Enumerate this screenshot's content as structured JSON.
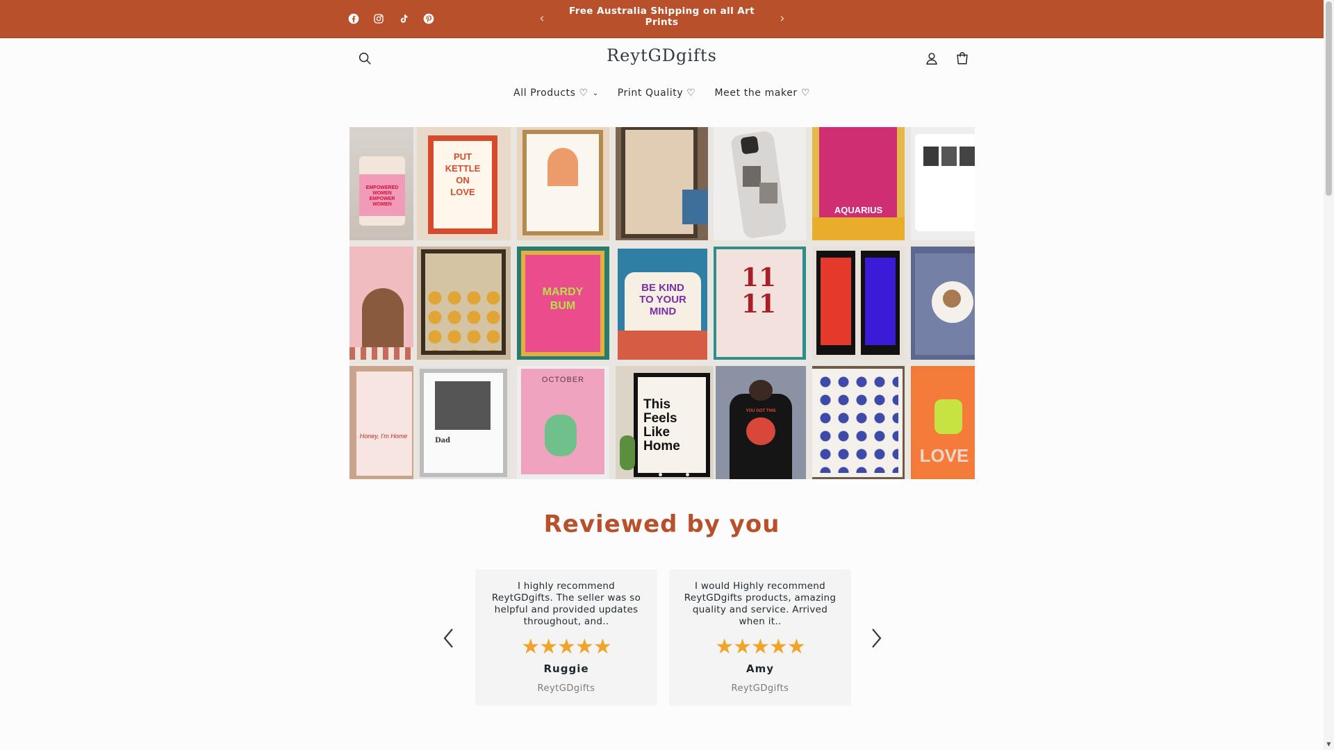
{
  "announcement": {
    "text": "Free Australia Shipping on all Art Prints",
    "prev_icon": "chevron-left-icon",
    "next_icon": "chevron-right-icon"
  },
  "social": [
    "facebook-icon",
    "instagram-icon",
    "tiktok-icon",
    "pinterest-icon"
  ],
  "header": {
    "logo": "ReytGDgifts",
    "search_icon": "search-icon",
    "account_icon": "account-icon",
    "cart_icon": "cart-icon"
  },
  "nav": {
    "items": [
      {
        "label": "All Products ♡",
        "has_dropdown": true
      },
      {
        "label": "Print Quality ♡"
      },
      {
        "label": "Meet the maker ♡"
      }
    ]
  },
  "collage": {
    "tiles": [
      {
        "name": "candle",
        "label": "EMPOWERED WOMEN EMPOWER WOMEN"
      },
      {
        "name": "kettle-print",
        "label": "PUT KETTLE ON LOVE"
      },
      {
        "name": "zodiac-portrait-print",
        "label": ""
      },
      {
        "name": "line-art-print",
        "label": ""
      },
      {
        "name": "photo-phone-case",
        "label": ""
      },
      {
        "name": "aquarius-print",
        "label": "AQUARIUS"
      },
      {
        "name": "photo-mug",
        "label": ""
      },
      {
        "name": "portrait-print",
        "label": ""
      },
      {
        "name": "face-line-print",
        "label": ""
      },
      {
        "name": "mardy-bum-print",
        "label": "MARDY BUM"
      },
      {
        "name": "be-kind-cushion",
        "label": "BE KIND TO YOUR MIND"
      },
      {
        "name": "angel-number-print",
        "label": "11 11"
      },
      {
        "name": "photo-strip-print",
        "label": ""
      },
      {
        "name": "teddy-print",
        "label": ""
      },
      {
        "name": "honey-heels-print",
        "label": "Honey, I'm Home"
      },
      {
        "name": "dad-photo-print",
        "label": "Dad"
      },
      {
        "name": "birth-flower-print",
        "label": "OCTOBER"
      },
      {
        "name": "home-print",
        "label": "This Feels Like Home"
      },
      {
        "name": "tshirt",
        "label": "YOU GOT THIS"
      },
      {
        "name": "blue-pattern-print",
        "label": ""
      },
      {
        "name": "love-print",
        "label": "LOVE"
      }
    ]
  },
  "reviews": {
    "title": "Reviewed by you",
    "prev_icon": "chevron-left-icon",
    "next_icon": "chevron-right-icon",
    "cards": [
      {
        "text": "I highly recommend ReytGDgifts. The seller was so helpful and provided updates throughout, and..",
        "stars": "★★★★★",
        "rating": 5,
        "name": "Ruggie",
        "source": "ReytGDgifts"
      },
      {
        "text": "I would Highly recommend ReytGDgifts products, amazing quality and service. Arrived when it..",
        "stars": "★★★★★",
        "rating": 5,
        "name": "Amy",
        "source": "ReytGDgifts"
      }
    ]
  },
  "colors": {
    "brand": "#b7502b",
    "star": "#f0a52a",
    "logo": "#2d3b41"
  }
}
